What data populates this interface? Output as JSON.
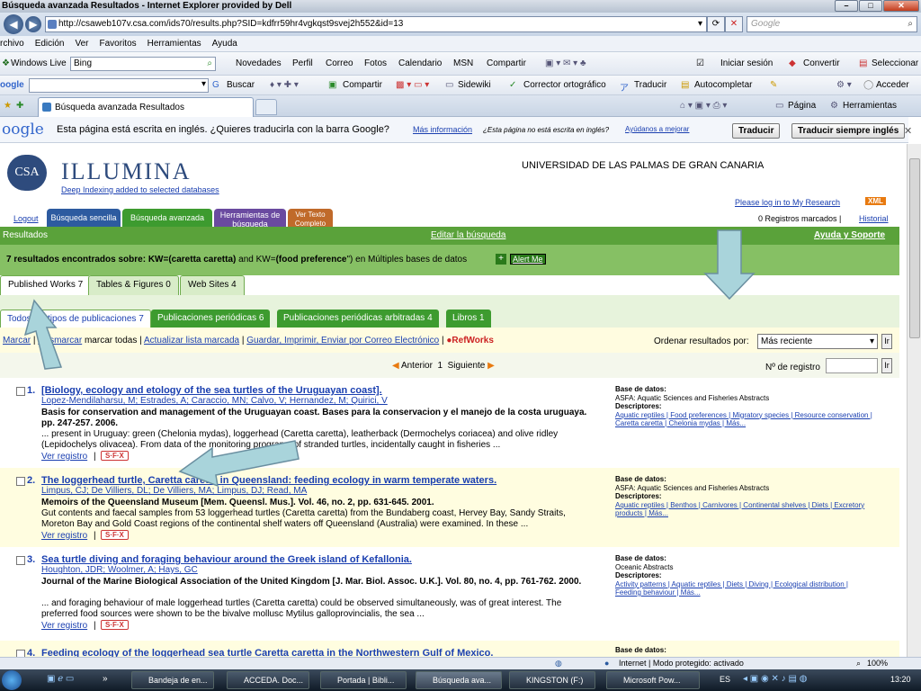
{
  "browser": {
    "title": "Búsqueda avanzada Resultados - Internet Explorer provided by Dell",
    "url": "http://csaweb107v.csa.com/ids70/results.php?SID=kdfrr59hr4vgkqst9svej2h552&id=13",
    "search_placeholder": "Google",
    "menu": [
      "rchivo",
      "Edición",
      "Ver",
      "Favoritos",
      "Herramientas",
      "Ayuda"
    ],
    "wl_label": "Windows Live",
    "wl_search": "Bing",
    "wl_links": [
      "Novedades",
      "Perfil",
      "Correo",
      "Fotos",
      "Calendario",
      "MSN",
      "Compartir"
    ],
    "wl_signin": "Iniciar sesión",
    "wl_convert": "Convertir",
    "wl_select": "Seleccionar",
    "gtb_label": "oogle",
    "gtb_buttons": [
      "Buscar",
      "Compartir",
      "Sidewiki",
      "Corrector ortográfico",
      "Traducir",
      "Autocompletar",
      "Acceder"
    ],
    "tab_title": "Búsqueda avanzada Resultados",
    "page_menu": "Página",
    "tools_menu": "Herramientas"
  },
  "translate_bar": {
    "logo": "oogle",
    "message": "Esta página está escrita en inglés. ¿Quieres traducirla con la barra Google?",
    "more_info": "Más información",
    "not_english": "¿Esta página no está escrita en inglés?",
    "help_link": "Ayúdanos a mejorar",
    "translate_btn": "Traducir",
    "always_btn": "Traducir siempre inglés"
  },
  "site": {
    "logo": "CSA",
    "brand": "ILLUMINA",
    "tagline": "Deep Indexing added to selected databases",
    "university": "UNIVERSIDAD DE LAS PALMAS DE GRAN CANARIA",
    "login_link": "Please log in to My Research",
    "xml": "XML",
    "marked": "0 Registros marcados |",
    "history": "Historial",
    "logout": "Logout",
    "tabs": [
      "Búsqueda sencilla",
      "Búsqueda avanzada",
      "Herramientas de búsqueda",
      "Ver Texto Completo"
    ]
  },
  "results": {
    "header": "Resultados",
    "edit_search": "Editar la búsqueda",
    "help": "Ayuda y Soporte",
    "summary_pre": "7 resultados encontrados sobre: KW=",
    "q1": "(caretta caretta)",
    "summary_and": " and KW=",
    "q2": "(food preference",
    "summary_post": "\") en Múltiples bases de datos",
    "alert": "Alert Me",
    "work_tabs": [
      "Published Works 7",
      "Tables & Figures 0",
      "Web Sites 4"
    ],
    "pub_tabs": [
      "Todos los tipos de publicaciones 7",
      "Publicaciones periódicas 6",
      "Publicaciones periódicas arbitradas 4",
      "Libros 1"
    ],
    "actions": [
      "Marcar",
      "Desmarcar",
      "marcar todas",
      "Actualizar lista marcada",
      "Guardar, Imprimir, Enviar por Correo Electrónico"
    ],
    "refworks": "RefWorks",
    "sort_label": "Ordenar resultados por:",
    "sort_value": "Más reciente",
    "go": "Ir",
    "prev": "Anterior",
    "page": "1",
    "next": "Siguiente",
    "reg_label": "Nº de registro",
    "view_record": "Ver registro",
    "sfx": "S·F·X"
  },
  "records": [
    {
      "num": "1.",
      "title": "[Biology, ecology and etology of the sea turtles of the Uruguayan coast].",
      "authors": "Lopez-Mendilaharsu, M; Estrades, A; Caraccio, MN; Calvo, V; Hernandez, M; Quirici, V",
      "source": "Basis for conservation and management of the Uruguayan coast. Bases para la conservacion y el manejo de la costa uruguaya. pp. 247-257. 2006.",
      "abstract": "... present in Uruguay: green (Chelonia mydas), loggerhead (Caretta caretta), leatherback (Dermochelys coriacea) and olive ridley (Lepidochelys olivacea). From data of the monitoring programs of stranded turtles, incidentally caught in fisheries ...",
      "db_label": "Base de datos:",
      "db": "ASFA: Aquatic Sciences and Fisheries Abstracts",
      "desc_label": "Descriptores:",
      "desc": "Aquatic reptiles | Food preferences | Migratory species | Resource conservation | Caretta caretta | Chelonia mydas | Más..."
    },
    {
      "num": "2.",
      "title": "The loggerhead turtle, Caretta caretta in Queensland: feeding ecology in warm temperate waters.",
      "authors": "Limpus, CJ; De Villiers, DL; De Villiers, MA; Limpus, DJ; Read, MA",
      "source": "Memoirs of the Queensland Museum [Mem. Queensl. Mus.]. Vol. 46, no. 2, pp. 631-645. 2001.",
      "abstract": "Gut contents and faecal samples from 53 loggerhead turtles (Caretta caretta) from the Bundaberg coast, Hervey Bay, Sandy Straits, Moreton Bay and Gold Coast regions of the continental shelf waters off Queensland (Australia) were examined. In these ...",
      "db_label": "Base de datos:",
      "db": "ASFA: Aquatic Sciences and Fisheries Abstracts",
      "desc_label": "Descriptores:",
      "desc": "Aquatic reptiles | Benthos | Carnivores | Continental shelves | Diets | Excretory products | Más..."
    },
    {
      "num": "3.",
      "title": "Sea turtle diving and foraging behaviour around the Greek island of Kefallonia.",
      "authors": "Houghton, JDR; Woolmer, A; Hays, GC",
      "source": "Journal of the Marine Biological Association of the United Kingdom [J. Mar. Biol. Assoc. U.K.]. Vol. 80, no. 4, pp. 761-762. 2000.",
      "abstract": "... and foraging behaviour of male loggerhead turtles (Caretta caretta) could be observed simultaneously, was of great interest. The preferred food sources were shown to be the bivalve mollusc Mytilus galloprovincialis, the sea ...",
      "db_label": "Base de datos:",
      "db": "Oceanic Abstracts",
      "desc_label": "Descriptores:",
      "desc": "Activity patterns | Aquatic reptiles | Diets | Diving | Ecological distribution | Feeding behaviour | Más..."
    },
    {
      "num": "4.",
      "title": "Feeding ecology of the loggerhead sea turtle Caretta caretta in the Northwestern Gulf of Mexico.",
      "db_label": "Base de datos:"
    }
  ],
  "statusbar": {
    "zone": "Internet | Modo protegido: activado",
    "zoom": "100%"
  },
  "taskbar": {
    "items": [
      "Bandeja de en...",
      "ACCEDA. Doc...",
      "Portada | Bibli...",
      "Búsqueda ava...",
      "KINGSTON (F:)",
      "Microsoft Pow..."
    ],
    "lang": "ES",
    "time": "13:20"
  }
}
